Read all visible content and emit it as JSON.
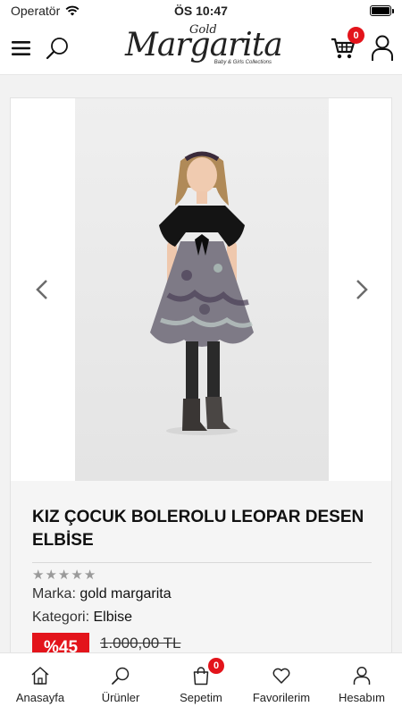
{
  "status_bar": {
    "carrier": "Operatör",
    "time": "ÖS 10:47"
  },
  "header": {
    "logo": {
      "top": "Gold",
      "main": "Margarita",
      "sub": "Baby & Girls Collections"
    },
    "cart_count": "0",
    "icons": {
      "menu": "menu-icon",
      "search": "search-icon",
      "cart": "cart-icon",
      "account": "user-icon"
    }
  },
  "product": {
    "title": "KIZ ÇOCUK BOLEROLU LEOPAR DESEN ELBİSE",
    "rating": 0,
    "brand_label": "Marka:",
    "brand_value": "gold margarita",
    "category_label": "Kategori:",
    "category_value": "Elbise",
    "discount": "%45",
    "old_price": "1.000,00 TL"
  },
  "tabbar": {
    "cart_count": "0",
    "items": [
      {
        "label": "Anasayfa",
        "icon": "home-icon"
      },
      {
        "label": "Ürünler",
        "icon": "search-icon"
      },
      {
        "label": "Sepetim",
        "icon": "bag-icon"
      },
      {
        "label": "Favorilerim",
        "icon": "heart-icon"
      },
      {
        "label": "Hesabım",
        "icon": "user-icon"
      }
    ]
  },
  "colors": {
    "accent": "#e3141b",
    "text": "#222222",
    "background": "#f2f2f2"
  }
}
